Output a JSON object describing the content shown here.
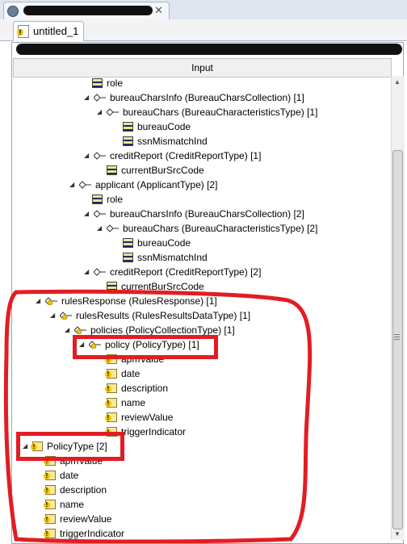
{
  "window": {
    "title": "untitled_1"
  },
  "editor": {
    "tab_label": "untitled_1",
    "column_header": "Input"
  },
  "tree": [
    {
      "label": "role",
      "icon": "element-icon",
      "twisty": "",
      "depth": 0
    },
    {
      "label": "bureauCharsInfo (BureauCharsCollection) [1]",
      "icon": "complex-icon",
      "twisty": "expanded",
      "depth": 0
    },
    {
      "label": "bureauChars (BureauCharacteristicsType) [1]",
      "icon": "complex-icon",
      "twisty": "expanded",
      "depth": 0
    },
    {
      "label": "bureauCode",
      "icon": "element-icon",
      "twisty": "",
      "depth": 0
    },
    {
      "label": "ssnMismatchInd",
      "icon": "element-icon",
      "twisty": "",
      "depth": 0
    },
    {
      "label": "creditReport (CreditReportType) [1]",
      "icon": "complex-icon",
      "twisty": "expanded",
      "depth": 0
    },
    {
      "label": "currentBurSrcCode",
      "icon": "element-icon",
      "twisty": "",
      "depth": 0
    },
    {
      "label": "applicant (ApplicantType) [2]",
      "icon": "complex-icon",
      "twisty": "expanded",
      "depth": 0
    },
    {
      "label": "role",
      "icon": "element-icon",
      "twisty": "",
      "depth": 0
    },
    {
      "label": "bureauCharsInfo (BureauCharsCollection) [2]",
      "icon": "complex-icon",
      "twisty": "expanded",
      "depth": 0
    },
    {
      "label": "bureauChars (BureauCharacteristicsType) [2]",
      "icon": "complex-icon",
      "twisty": "expanded",
      "depth": 0
    },
    {
      "label": "bureauCode",
      "icon": "element-icon",
      "twisty": "",
      "depth": 0
    },
    {
      "label": "ssnMismatchInd",
      "icon": "element-icon",
      "twisty": "",
      "depth": 0
    },
    {
      "label": "creditReport (CreditReportType) [2]",
      "icon": "complex-icon",
      "twisty": "expanded",
      "depth": 0
    },
    {
      "label": "currentBurSrcCode",
      "icon": "element-icon",
      "twisty": "",
      "depth": 0
    },
    {
      "label": "rulesResponse (RulesResponse) [1]",
      "icon": "warning-complex-icon",
      "twisty": "expanded",
      "depth": 0
    },
    {
      "label": "rulesResults (RulesResultsDataType) [1]",
      "icon": "warning-complex-icon",
      "twisty": "expanded",
      "depth": 0
    },
    {
      "label": "policies (PolicyCollectionType) [1]",
      "icon": "warning-complex-icon",
      "twisty": "expanded",
      "depth": 0
    },
    {
      "label": "policy (PolicyType) [1]",
      "icon": "warning-complex-icon",
      "twisty": "expanded",
      "depth": 0
    },
    {
      "label": "apmValue",
      "icon": "warning-element-icon",
      "twisty": "",
      "depth": 0
    },
    {
      "label": "date",
      "icon": "warning-element-icon",
      "twisty": "",
      "depth": 0
    },
    {
      "label": "description",
      "icon": "warning-element-icon",
      "twisty": "",
      "depth": 0
    },
    {
      "label": "name",
      "icon": "warning-element-icon",
      "twisty": "",
      "depth": 0
    },
    {
      "label": "reviewValue",
      "icon": "warning-element-icon",
      "twisty": "",
      "depth": 0
    },
    {
      "label": "triggerIndicator",
      "icon": "warning-element-icon",
      "twisty": "",
      "depth": 0
    },
    {
      "label": "PolicyType [2]",
      "icon": "warning-element-icon",
      "twisty": "expanded",
      "depth": 0
    },
    {
      "label": "apmValue",
      "icon": "warning-element-icon",
      "twisty": "",
      "depth": 0
    },
    {
      "label": "date",
      "icon": "warning-element-icon",
      "twisty": "",
      "depth": 0
    },
    {
      "label": "description",
      "icon": "warning-element-icon",
      "twisty": "",
      "depth": 0
    },
    {
      "label": "name",
      "icon": "warning-element-icon",
      "twisty": "",
      "depth": 0
    },
    {
      "label": "reviewValue",
      "icon": "warning-element-icon",
      "twisty": "",
      "depth": 0
    },
    {
      "label": "triggerIndicator",
      "icon": "warning-element-icon",
      "twisty": "",
      "depth": 0
    }
  ],
  "colors": {
    "annotation_red": "#e21d24",
    "header_bg": "#f0f0f0",
    "window_chrome": "#dfe6ef"
  }
}
